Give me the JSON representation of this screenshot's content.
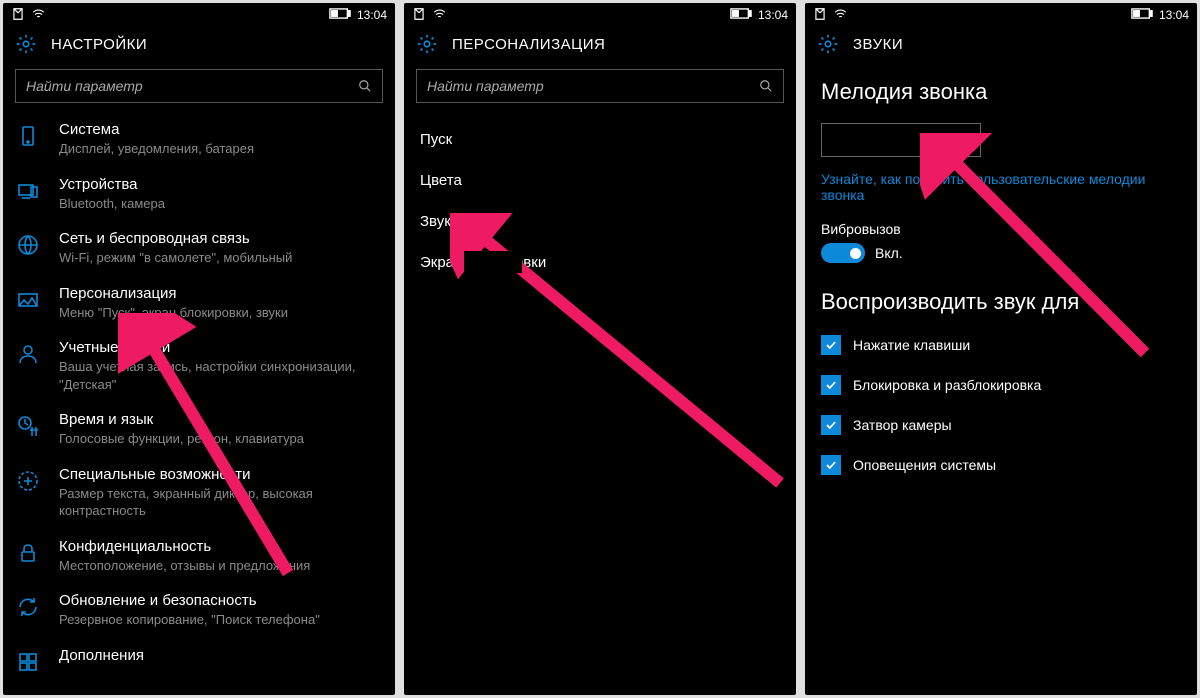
{
  "status": {
    "time": "13:04"
  },
  "screens": [
    {
      "title": "НАСТРОЙКИ",
      "search_placeholder": "Найти параметр",
      "items": [
        {
          "label": "Система",
          "sub": "Дисплей, уведомления, батарея"
        },
        {
          "label": "Устройства",
          "sub": "Bluetooth, камера"
        },
        {
          "label": "Сеть и беспроводная связь",
          "sub": "Wi-Fi, режим \"в самолете\", мобильный"
        },
        {
          "label": "Персонализация",
          "sub": "Меню \"Пуск\", экран блокировки, звуки"
        },
        {
          "label": "Учетные записи",
          "sub": "Ваша учетная запись, настройки синхронизации, \"Детская\""
        },
        {
          "label": "Время и язык",
          "sub": "Голосовые функции, регион, клавиатура"
        },
        {
          "label": "Специальные возможности",
          "sub": "Размер текста, экранный диктор, высокая контрастность"
        },
        {
          "label": "Конфиденциальность",
          "sub": "Местоположение, отзывы и предложения"
        },
        {
          "label": "Обновление и безопасность",
          "sub": "Резервное копирование, \"Поиск телефона\""
        },
        {
          "label": "Дополнения",
          "sub": ""
        }
      ]
    },
    {
      "title": "ПЕРСОНАЛИЗАЦИЯ",
      "search_placeholder": "Найти параметр",
      "plain_items": [
        "Пуск",
        "Цвета",
        "Звуки",
        "Экран блокировки"
      ]
    },
    {
      "title": "ЗВУКИ",
      "ringtone_heading": "Мелодия звонка",
      "help_link": "Узнайте, как получить пользовательские мелодии звонка",
      "vibrate_label": "Вибровызов",
      "vibrate_state": "Вкл.",
      "playfor_heading": "Воспроизводить звук для",
      "checkboxes": [
        "Нажатие клавиши",
        "Блокировка и разблокировка",
        "Затвор камеры",
        "Оповещения системы"
      ]
    }
  ]
}
